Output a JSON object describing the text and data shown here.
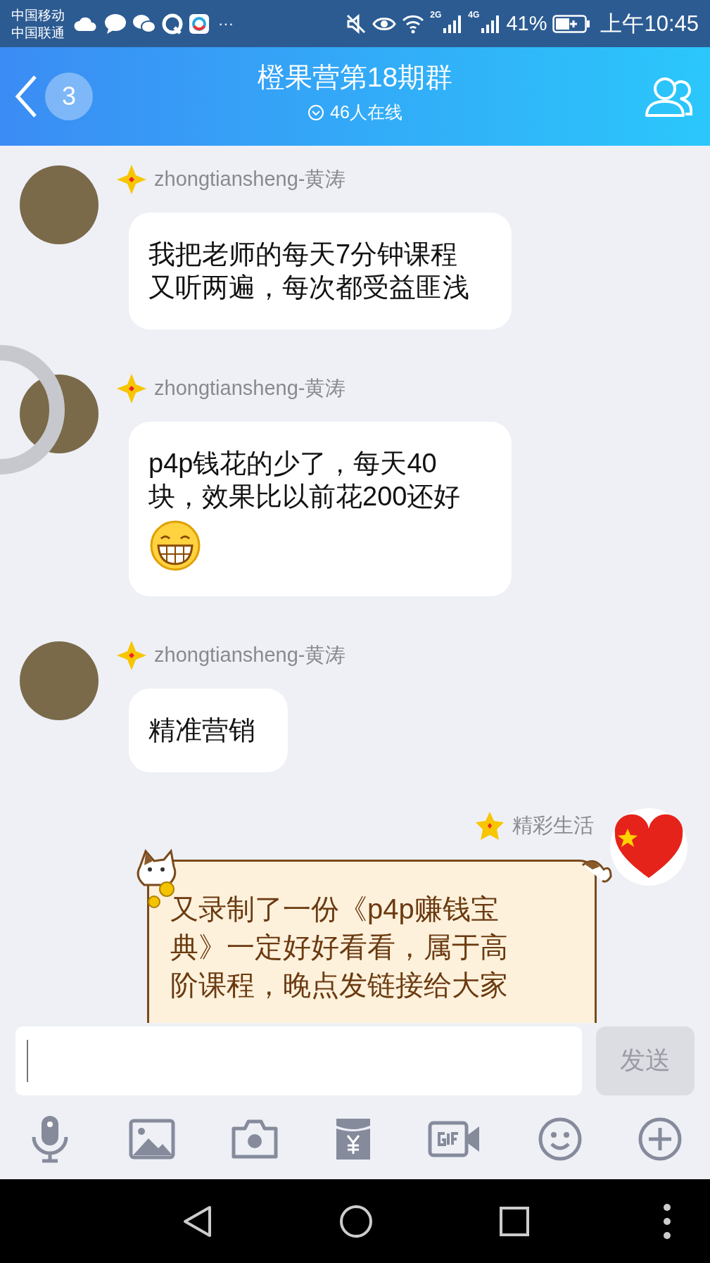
{
  "status_bar": {
    "carriers": [
      "中国移动",
      "中国联通"
    ],
    "more": "···",
    "network_labels": [
      "2G",
      "4G"
    ],
    "battery": "41%",
    "time": "上午10:45"
  },
  "header": {
    "unread_count": "3",
    "title": "橙果营第18期群",
    "online": "46人在线"
  },
  "messages": [
    {
      "kind": "received",
      "sender": "zhongtiansheng-黄涛",
      "text": "我把老师的每天7分钟课程又听两遍，每次都受益匪浅",
      "emoji": false
    },
    {
      "kind": "received",
      "sender": "zhongtiansheng-黄涛",
      "text": "p4p钱花的少了，每天40块，效果比以前花200还好",
      "emoji": true
    },
    {
      "kind": "received",
      "sender": "zhongtiansheng-黄涛",
      "text": "精准营销",
      "emoji": false
    },
    {
      "kind": "sent",
      "sender": "精彩生活",
      "text": "又录制了一份《p4p赚钱宝典》一定好好看看，属于高阶课程，晚点发链接给大家",
      "emoji": false
    }
  ],
  "composer": {
    "send_label": "发送",
    "send_disabled": true
  }
}
